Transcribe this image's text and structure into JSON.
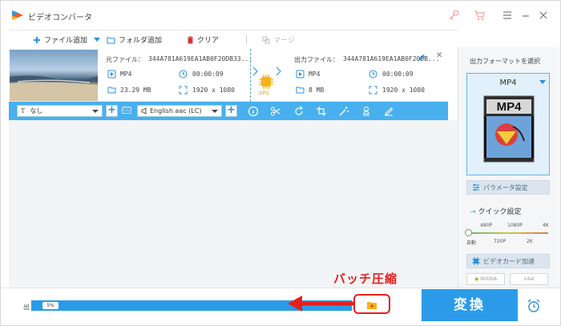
{
  "window": {
    "title": "ビデオコンバータ"
  },
  "toolbar": {
    "add_file": "ファイル追加",
    "add_folder": "フォルダ追加",
    "clear": "クリア",
    "merge": "マージ"
  },
  "source": {
    "name_label": "元ファイル：",
    "name_value": "344A781A619EA1AB0F20DB33...",
    "format": "MP4",
    "duration": "00:00:09",
    "size": "23.29 MB",
    "resolution": "1920 x 1080"
  },
  "output": {
    "name_label": "出力ファイル：",
    "name_value": "344A781A619EA1AB0F20DB...",
    "format": "MP4",
    "duration": "00:00:09",
    "size": "8 MB",
    "resolution": "1920 x 1080"
  },
  "gpu_label": "GPU",
  "editbar": {
    "subtitle_value": "なし",
    "subtitle_prefix": "T",
    "cc_label": "CC",
    "audio_value": "English aac (LC)"
  },
  "right_panel": {
    "title": "出力フォーマットを選択",
    "format_name": "MP4",
    "format_badge": "MP4",
    "params_button": "パラメータ設定",
    "quick_label": "クイック設定",
    "quick_top_ticks": [
      "480P",
      "1080P",
      "4K"
    ],
    "quick_bottom_ticks": [
      "自動",
      "720P",
      "2K"
    ],
    "gpu_accel": "ビデオカード加速",
    "vendors": [
      "NVIDIA",
      "intel"
    ]
  },
  "bottom": {
    "output_label": "出",
    "progress_text": "5%",
    "progress_fraction": 0.05,
    "convert_button": "変換"
  },
  "annotation": {
    "text": "バッチ圧縮",
    "color": "#e5201c"
  },
  "colors": {
    "accent": "#2b9be9",
    "editbar": "#48b0ee"
  }
}
